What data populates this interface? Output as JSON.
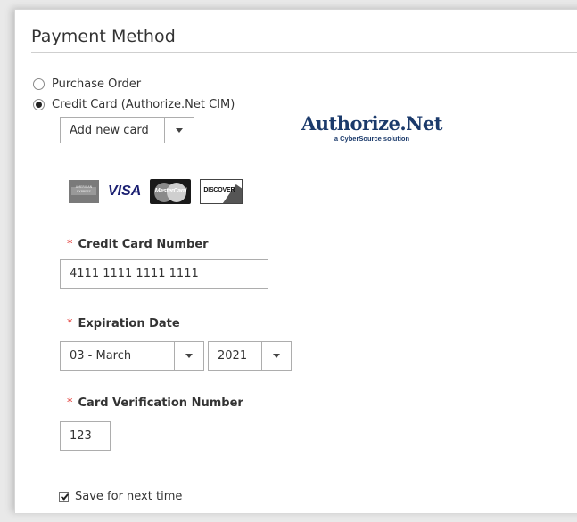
{
  "section": {
    "title": "Payment Method"
  },
  "payment_options": [
    {
      "label": "Purchase Order",
      "checked": false
    },
    {
      "label": "Credit Card (Authorize.Net CIM)",
      "checked": true
    }
  ],
  "saved_card_select": {
    "value": "Add new card"
  },
  "provider_logo": {
    "name": "Authorize.Net",
    "tagline": "a CyberSource solution",
    "color": "#1b3a6b"
  },
  "card_brands": [
    {
      "name": "American Express",
      "icon": "amex-card-icon",
      "text": "AMERICAN EXPRESS"
    },
    {
      "name": "Visa",
      "icon": "visa-card-icon",
      "text": "VISA"
    },
    {
      "name": "MasterCard",
      "icon": "mastercard-card-icon",
      "text": "MasterCard"
    },
    {
      "name": "Discover",
      "icon": "discover-card-icon",
      "text": "DISCOVER"
    }
  ],
  "fields": {
    "card_number": {
      "label": "Credit Card Number",
      "required_mark": "*",
      "value": "4111 1111 1111 1111"
    },
    "expiration": {
      "label": "Expiration Date",
      "required_mark": "*",
      "month": "03 - March",
      "year": "2021"
    },
    "cvv": {
      "label": "Card Verification Number",
      "required_mark": "*",
      "value": "123"
    }
  },
  "save_card": {
    "label": "Save for next time",
    "checked": true
  },
  "colors": {
    "required": "#e02b27",
    "border": "#adadad",
    "text": "#333333"
  }
}
